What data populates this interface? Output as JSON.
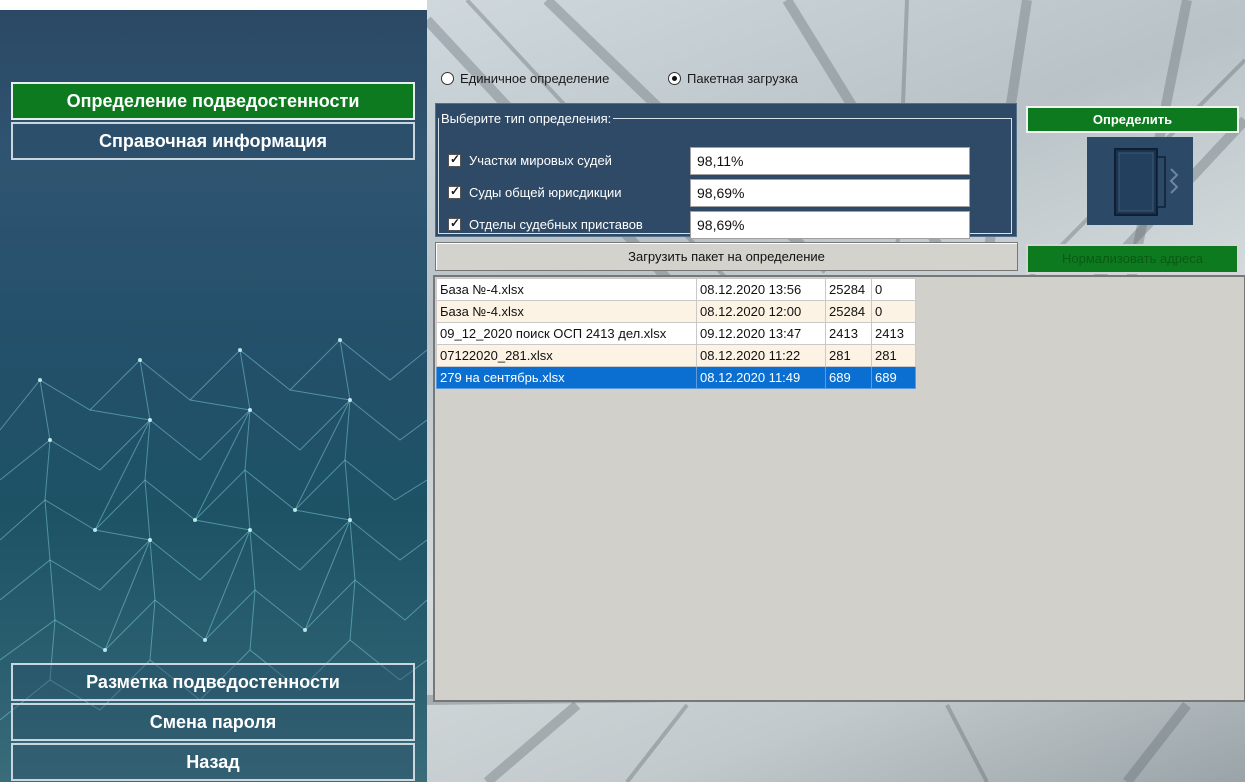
{
  "sidebar": {
    "top_items": [
      {
        "label": "Определение подведостенности",
        "active": true
      },
      {
        "label": "Справочная информация",
        "active": false
      }
    ],
    "bottom_items": [
      {
        "label": "Разметка подведостенности"
      },
      {
        "label": "Смена пароля"
      },
      {
        "label": "Назад"
      }
    ]
  },
  "mode": {
    "single_label": "Единичное определение",
    "batch_label": "Пакетная загрузка",
    "selected": "batch"
  },
  "type_panel": {
    "legend": "Выберите тип определения:",
    "rows": [
      {
        "label": "Участки мировых судей",
        "checked": true,
        "value": "98,11%"
      },
      {
        "label": "Суды общей юрисдикции",
        "checked": true,
        "value": "98,69%"
      },
      {
        "label": "Отделы судебных приставов",
        "checked": true,
        "value": "98,69%"
      }
    ]
  },
  "actions": {
    "detect_label": "Определить",
    "normalize_label": "Нормализовать адреса",
    "upload_label": "Загрузить пакет на определение"
  },
  "files": [
    [
      "База №-4.xlsx",
      "08.12.2020 13:56",
      "25284",
      "0"
    ],
    [
      "База №-4.xlsx",
      "08.12.2020 12:00",
      "25284",
      "0"
    ],
    [
      "09_12_2020 поиск ОСП 2413 дел.xlsx",
      "09.12.2020 13:47",
      "2413",
      "2413"
    ],
    [
      "07122020_281.xlsx",
      "08.12.2020 11:22",
      "281",
      "281"
    ],
    [
      "279 на сентябрь.xlsx",
      "08.12.2020 11:49",
      "689",
      "689"
    ]
  ],
  "selected_file_index": 4,
  "icons": {
    "folder": "folder-icon"
  },
  "colors": {
    "accent_green": "#0e7a1f",
    "panel_blue": "#2e4a66",
    "selection_blue": "#0a6fd0"
  }
}
